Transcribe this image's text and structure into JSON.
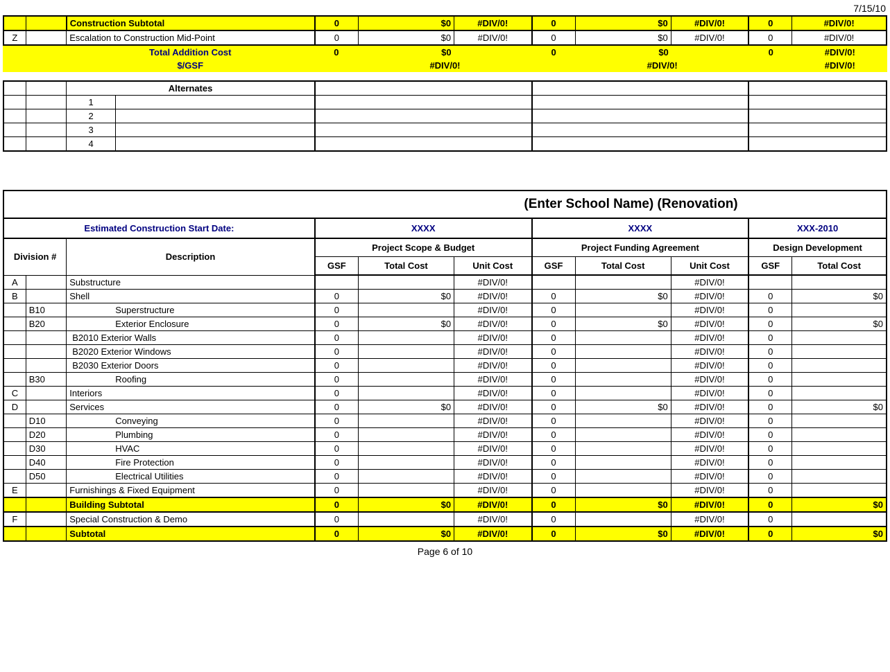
{
  "header": {
    "date": "7/15/10"
  },
  "upper": {
    "construction_subtotal": {
      "label": "Construction Subtotal",
      "g1": "0",
      "t1": "$0",
      "u1": "#DIV/0!",
      "g2": "0",
      "t2": "$0",
      "u2": "#DIV/0!",
      "g3": "0",
      "u3": "#DIV/0!"
    },
    "escalation": {
      "code": "Z",
      "label": "Escalation to Construction Mid-Point",
      "g1": "0",
      "t1": "$0",
      "u1": "#DIV/0!",
      "g2": "0",
      "t2": "$0",
      "u2": "#DIV/0!",
      "g3": "0",
      "u3": "#DIV/0!"
    },
    "total_addition": {
      "label": "Total Addition Cost",
      "g1": "0",
      "t1": "$0",
      "g2": "0",
      "t2": "$0",
      "g3": "0",
      "u3": "#DIV/0!"
    },
    "per_gsf": {
      "label": "$/GSF",
      "v1": "#DIV/0!",
      "v2": "#DIV/0!",
      "v3": "#DIV/0!"
    }
  },
  "alternates": {
    "header": "Alternates",
    "rows": [
      "1",
      "2",
      "3",
      "4"
    ]
  },
  "lower": {
    "title": "(Enter School Name) (Renovation)",
    "start_date_label": "Estimated Construction Start Date:",
    "phase1": "XXXX",
    "phase2": "XXXX",
    "phase3": "XXX-2010",
    "group1": "Project Scope & Budget",
    "group2": "Project Funding Agreement",
    "group3": "Design Development",
    "col_division": "Division #",
    "col_desc": "Description",
    "col_gsf": "GSF",
    "col_tc": "Total Cost",
    "col_uc": "Unit Cost",
    "rows": [
      {
        "a": "A",
        "b": "",
        "desc": "Substructure",
        "g1": "",
        "t1": "",
        "u1": "#DIV/0!",
        "g2": "",
        "t2": "",
        "u2": "#DIV/0!",
        "g3": "",
        "t3": ""
      },
      {
        "a": "B",
        "b": "",
        "desc": "Shell",
        "g1": "0",
        "t1": "$0",
        "u1": "#DIV/0!",
        "g2": "0",
        "t2": "$0",
        "u2": "#DIV/0!",
        "g3": "0",
        "t3": "$0"
      },
      {
        "a": "",
        "b": "B10",
        "desc": "Superstructure",
        "indent": 1,
        "g1": "0",
        "t1": "",
        "u1": "#DIV/0!",
        "g2": "0",
        "t2": "",
        "u2": "#DIV/0!",
        "g3": "0",
        "t3": ""
      },
      {
        "a": "",
        "b": "B20",
        "desc": "Exterior Enclosure",
        "indent": 1,
        "g1": "0",
        "t1": "$0",
        "u1": "#DIV/0!",
        "g2": "0",
        "t2": "$0",
        "u2": "#DIV/0!",
        "g3": "0",
        "t3": "$0"
      },
      {
        "a": "",
        "b": "",
        "desc": "B2010    Exterior Walls",
        "indent": 2,
        "g1": "0",
        "t1": "",
        "u1": "#DIV/0!",
        "g2": "0",
        "t2": "",
        "u2": "#DIV/0!",
        "g3": "0",
        "t3": ""
      },
      {
        "a": "",
        "b": "",
        "desc": "B2020    Exterior Windows",
        "indent": 2,
        "g1": "0",
        "t1": "",
        "u1": "#DIV/0!",
        "g2": "0",
        "t2": "",
        "u2": "#DIV/0!",
        "g3": "0",
        "t3": ""
      },
      {
        "a": "",
        "b": "",
        "desc": "B2030    Exterior Doors",
        "indent": 2,
        "g1": "0",
        "t1": "",
        "u1": "#DIV/0!",
        "g2": "0",
        "t2": "",
        "u2": "#DIV/0!",
        "g3": "0",
        "t3": ""
      },
      {
        "a": "",
        "b": "B30",
        "desc": "Roofing",
        "indent": 1,
        "g1": "0",
        "t1": "",
        "u1": "#DIV/0!",
        "g2": "0",
        "t2": "",
        "u2": "#DIV/0!",
        "g3": "0",
        "t3": ""
      },
      {
        "a": "C",
        "b": "",
        "desc": "Interiors",
        "g1": "0",
        "t1": "",
        "u1": "#DIV/0!",
        "g2": "0",
        "t2": "",
        "u2": "#DIV/0!",
        "g3": "0",
        "t3": ""
      },
      {
        "a": "D",
        "b": "",
        "desc": "Services",
        "g1": "0",
        "t1": "$0",
        "u1": "#DIV/0!",
        "g2": "0",
        "t2": "$0",
        "u2": "#DIV/0!",
        "g3": "0",
        "t3": "$0"
      },
      {
        "a": "",
        "b": "D10",
        "desc": "Conveying",
        "indent": 1,
        "g1": "0",
        "t1": "",
        "u1": "#DIV/0!",
        "g2": "0",
        "t2": "",
        "u2": "#DIV/0!",
        "g3": "0",
        "t3": ""
      },
      {
        "a": "",
        "b": "D20",
        "desc": "Plumbing",
        "indent": 1,
        "g1": "0",
        "t1": "",
        "u1": "#DIV/0!",
        "g2": "0",
        "t2": "",
        "u2": "#DIV/0!",
        "g3": "0",
        "t3": ""
      },
      {
        "a": "",
        "b": "D30",
        "desc": "HVAC",
        "indent": 1,
        "g1": "0",
        "t1": "",
        "u1": "#DIV/0!",
        "g2": "0",
        "t2": "",
        "u2": "#DIV/0!",
        "g3": "0",
        "t3": ""
      },
      {
        "a": "",
        "b": "D40",
        "desc": "Fire Protection",
        "indent": 1,
        "g1": "0",
        "t1": "",
        "u1": "#DIV/0!",
        "g2": "0",
        "t2": "",
        "u2": "#DIV/0!",
        "g3": "0",
        "t3": ""
      },
      {
        "a": "",
        "b": "D50",
        "desc": "Electrical Utilities",
        "indent": 1,
        "g1": "0",
        "t1": "",
        "u1": "#DIV/0!",
        "g2": "0",
        "t2": "",
        "u2": "#DIV/0!",
        "g3": "0",
        "t3": ""
      },
      {
        "a": "E",
        "b": "",
        "desc": "Furnishings & Fixed Equipment",
        "g1": "0",
        "t1": "",
        "u1": "#DIV/0!",
        "g2": "0",
        "t2": "",
        "u2": "#DIV/0!",
        "g3": "0",
        "t3": ""
      }
    ],
    "building_subtotal": {
      "label": "Building Subtotal",
      "g1": "0",
      "t1": "$0",
      "u1": "#DIV/0!",
      "g2": "0",
      "t2": "$0",
      "u2": "#DIV/0!",
      "g3": "0",
      "t3": "$0"
    },
    "special": {
      "a": "F",
      "label": "Special Construction & Demo",
      "g1": "0",
      "t1": "",
      "u1": "#DIV/0!",
      "g2": "0",
      "t2": "",
      "u2": "#DIV/0!",
      "g3": "0",
      "t3": ""
    },
    "subtotal": {
      "label": "Subtotal",
      "g1": "0",
      "t1": "$0",
      "u1": "#DIV/0!",
      "g2": "0",
      "t2": "$0",
      "u2": "#DIV/0!",
      "g3": "0",
      "t3": "$0"
    }
  },
  "footer": {
    "page": "Page 6 of 10"
  }
}
